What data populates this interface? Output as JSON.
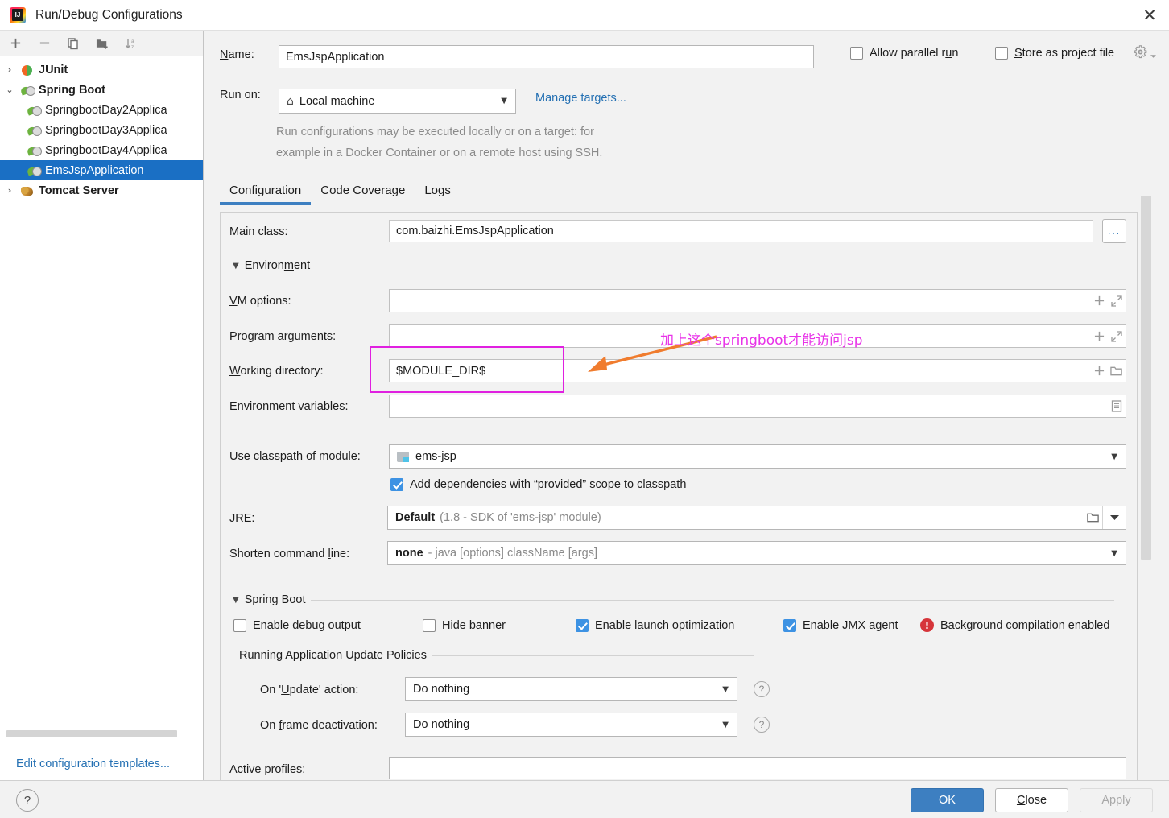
{
  "window": {
    "title": "Run/Debug Configurations",
    "app_icon": "intellij-idea-icon",
    "close_label": "✕"
  },
  "sidebar": {
    "toolbar": [
      {
        "name": "add-configuration-button",
        "glyph": "＋"
      },
      {
        "name": "remove-configuration-button",
        "glyph": "－"
      },
      {
        "name": "copy-configuration-button",
        "glyph": "❐"
      },
      {
        "name": "new-folder-button",
        "glyph": "🗀"
      },
      {
        "name": "sort-configurations-button",
        "glyph": "↓"
      }
    ],
    "tree": [
      {
        "label": "JUnit",
        "icon": "junit-icon",
        "twisty": "›",
        "level": 0,
        "bold": true,
        "selected": false
      },
      {
        "label": "Spring Boot",
        "icon": "spring-boot-icon",
        "twisty": "⌄",
        "level": 0,
        "bold": true,
        "selected": false
      },
      {
        "label": "SpringbootDay2Applica",
        "icon": "spring-boot-icon",
        "twisty": "",
        "level": 1,
        "bold": false,
        "selected": false
      },
      {
        "label": "SpringbootDay3Applica",
        "icon": "spring-boot-icon",
        "twisty": "",
        "level": 1,
        "bold": false,
        "selected": false
      },
      {
        "label": "SpringbootDay4Applica",
        "icon": "spring-boot-icon",
        "twisty": "",
        "level": 1,
        "bold": false,
        "selected": false
      },
      {
        "label": "EmsJspApplication",
        "icon": "spring-boot-icon",
        "twisty": "",
        "level": 1,
        "bold": false,
        "selected": true
      },
      {
        "label": "Tomcat Server",
        "icon": "tomcat-icon",
        "twisty": "›",
        "level": 0,
        "bold": true,
        "selected": false
      }
    ],
    "edit_templates_link": "Edit configuration templates..."
  },
  "header": {
    "name_label": "Name:",
    "name_value": "EmsJspApplication",
    "run_on_label": "Run on:",
    "run_on_value": "Local machine",
    "run_on_icon": "home-icon",
    "manage_targets_link": "Manage targets...",
    "hint_line1": "Run configurations may be executed locally or on a target: for",
    "hint_line2": "example in a Docker Container or on a remote host using SSH.",
    "allow_parallel_run_label": "Allow parallel run",
    "allow_parallel_run_checked": false,
    "store_as_project_file_label": "Store as project file",
    "store_as_project_file_checked": false,
    "gear_icon": "gear-icon"
  },
  "tabs": [
    {
      "label": "Configuration",
      "active": true
    },
    {
      "label": "Code Coverage",
      "active": false
    },
    {
      "label": "Logs",
      "active": false
    }
  ],
  "configuration": {
    "main_class_label": "Main class:",
    "main_class_value": "com.baizhi.EmsJspApplication",
    "main_class_browse": "...",
    "environment_section": "Environment",
    "vm_options_label": "VM options:",
    "vm_options_value": "",
    "program_arguments_label": "Program arguments:",
    "program_arguments_value": "",
    "working_directory_label": "Working directory:",
    "working_directory_value": "$MODULE_DIR$",
    "environment_variables_label": "Environment variables:",
    "environment_variables_value": "",
    "use_classpath_label": "Use classpath of module:",
    "use_classpath_value": "ems-jsp",
    "add_dependencies_label": "Add dependencies with “provided” scope to classpath",
    "add_dependencies_checked": true,
    "jre_label": "JRE:",
    "jre_value": "Default",
    "jre_hint": "(1.8 - SDK of 'ems-jsp' module)",
    "shorten_cmd_label": "Shorten command line:",
    "shorten_cmd_value": "none",
    "shorten_cmd_hint": "- java [options] className [args]"
  },
  "spring_boot_section": {
    "title": "Spring Boot",
    "checkboxes": [
      {
        "label": "Enable debug output",
        "checked": false,
        "name": "enable-debug-output-checkbox"
      },
      {
        "label": "Hide banner",
        "checked": false,
        "name": "hide-banner-checkbox"
      },
      {
        "label": "Enable launch optimization",
        "checked": true,
        "name": "enable-launch-optimization-checkbox"
      },
      {
        "label": "Enable JMX agent",
        "checked": true,
        "name": "enable-jmx-agent-checkbox"
      }
    ],
    "background_compilation_text": "Background compilation enabled",
    "background_compilation_icon": "error-icon",
    "update_policies_title": "Running Application Update Policies",
    "on_update_label": "On 'Update' action:",
    "on_update_value": "Do nothing",
    "on_frame_deactivation_label": "On frame deactivation:",
    "on_frame_deactivation_value": "Do nothing",
    "active_profiles_label": "Active profiles:",
    "active_profiles_value": ""
  },
  "annotation": {
    "text": "加上这个springboot才能访问jsp",
    "color": "#e832e8",
    "arrow_color": "#f07c2e",
    "box_color": "#e020e0"
  },
  "footer": {
    "help_label": "?",
    "ok_label": "OK",
    "close_label": "Close",
    "apply_label": "Apply",
    "apply_enabled": false
  },
  "colors": {
    "accent": "#3d7fc1",
    "selection": "#1a6fc4",
    "link": "#2470b3",
    "background": "#f2f2f2",
    "error": "#d6353a"
  }
}
